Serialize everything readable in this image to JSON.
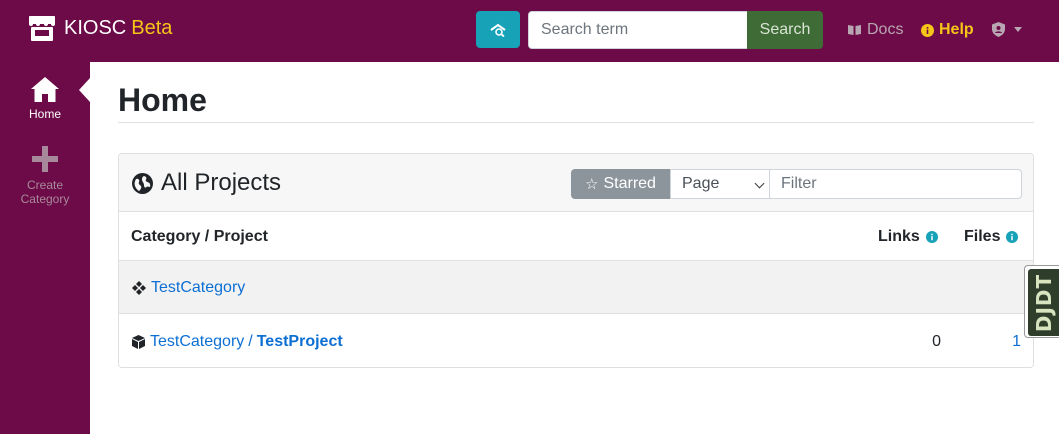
{
  "brand": {
    "name": "KIOSC",
    "badge": "Beta"
  },
  "search": {
    "placeholder": "Search term",
    "button_label": "Search"
  },
  "nav": {
    "docs_label": "Docs",
    "help_label": "Help"
  },
  "sidebar": {
    "items": [
      {
        "icon": "home-icon",
        "label": "Home",
        "active": true
      },
      {
        "icon": "plus-icon",
        "label": "Create Category",
        "active": false
      }
    ]
  },
  "page": {
    "title": "Home"
  },
  "projects_card": {
    "title": "All Projects",
    "starred_label": "Starred",
    "page_select_value": "Page",
    "filter_placeholder": "Filter",
    "columns": {
      "name": "Category / Project",
      "links": "Links",
      "files": "Files"
    },
    "rows": [
      {
        "type": "category",
        "name": "TestCategory"
      },
      {
        "type": "project",
        "category": "TestCategory",
        "separator": "/",
        "name": "TestProject",
        "links": "0",
        "files": "1"
      }
    ]
  },
  "debug_toolbar": {
    "label": "DJDT"
  },
  "colors": {
    "brand_bg": "#6d0b48",
    "beta": "#f5c518",
    "search_adv_btn": "#17a2b8",
    "search_btn": "#3e6b36",
    "link": "#0c6fd3",
    "info_icon": "#17a2b8",
    "starred_btn": "#8c959c"
  }
}
